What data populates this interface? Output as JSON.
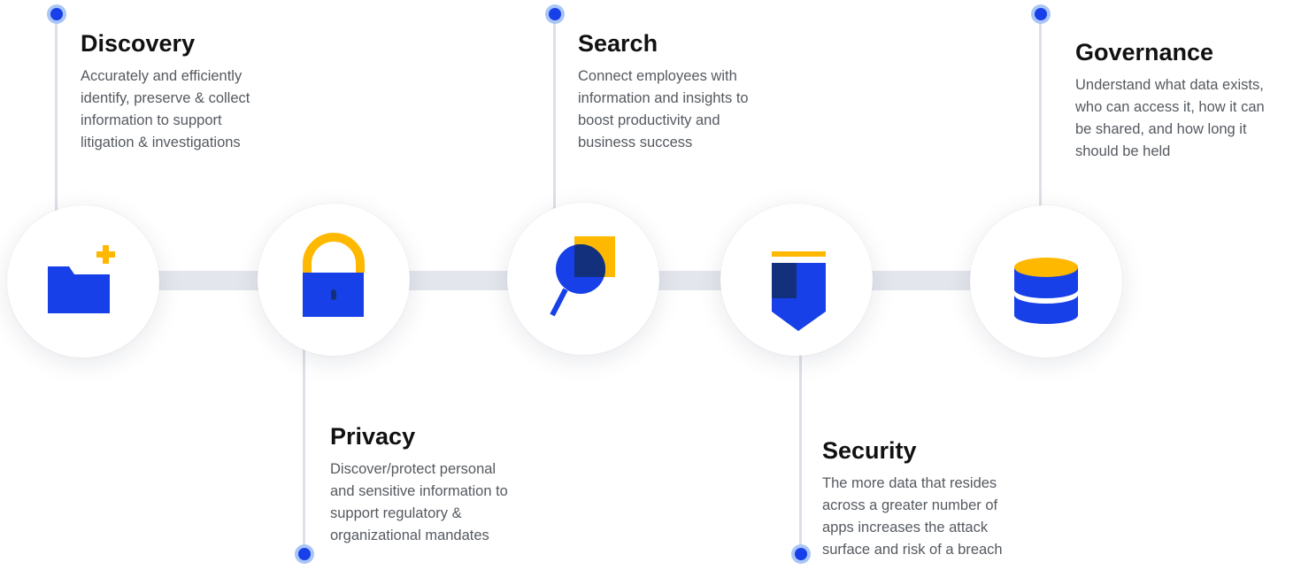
{
  "colors": {
    "primary": "#1740e8",
    "accent": "#ffb800",
    "navy": "#13307c",
    "ring": "#a9c6f6",
    "line": "#e3e6ec"
  },
  "nodes": [
    {
      "icon": "folder-plus-icon",
      "title": "Discovery",
      "lines": [
        "Accurately and efficiently",
        "identify, preserve & collect",
        "information to support",
        "litigation & investigations"
      ]
    },
    {
      "icon": "padlock-icon",
      "title": "Privacy",
      "lines": [
        "Discover/protect personal",
        "and sensitive information to",
        "support regulatory &",
        "organizational mandates"
      ]
    },
    {
      "icon": "magnifier-icon",
      "title": "Search",
      "lines": [
        "Connect employees with",
        "information and insights to",
        "boost productivity and",
        "business success"
      ]
    },
    {
      "icon": "shield-icon",
      "title": "Security",
      "lines": [
        "The more data that resides",
        "across a greater number of",
        "apps increases the attack",
        "surface and risk of a breach"
      ]
    },
    {
      "icon": "database-icon",
      "title": "Governance",
      "lines": [
        "Understand what data exists,",
        "who can access it, how it can",
        "be shared, and how long it",
        "should be held"
      ]
    }
  ]
}
